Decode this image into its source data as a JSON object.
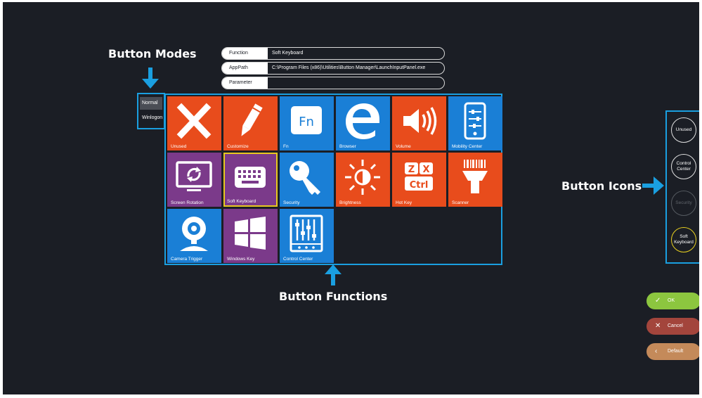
{
  "callouts": {
    "button_modes": "Button Modes",
    "button_functions": "Button Functions",
    "button_icons": "Button Icons"
  },
  "fields": [
    {
      "label": "Function",
      "value": "Soft Keyboard"
    },
    {
      "label": "AppPath",
      "value": "C:\\Program Files (x86)\\Utilities\\Button Manager\\LaunchInputPanel.exe"
    },
    {
      "label": "Parameter",
      "value": ""
    }
  ],
  "modes": [
    {
      "label": "Normal",
      "selected": true
    },
    {
      "label": "Winlogon",
      "selected": false
    }
  ],
  "tiles": [
    {
      "label": "Unused",
      "color": "#e84c1c",
      "icon": "close-x-icon"
    },
    {
      "label": "Customize",
      "color": "#e84c1c",
      "icon": "pencil-icon"
    },
    {
      "label": "Fn",
      "color": "#1a7fd6",
      "icon": "fn-key-icon"
    },
    {
      "label": "Browser",
      "color": "#1a7fd6",
      "icon": "edge-browser-icon"
    },
    {
      "label": "Volume",
      "color": "#e84c1c",
      "icon": "speaker-icon"
    },
    {
      "label": "Mobility Center",
      "color": "#1a7fd6",
      "icon": "mobility-sliders-icon"
    },
    {
      "label": "Screen Rotation",
      "color": "#7b3a8a",
      "icon": "screen-rotation-icon"
    },
    {
      "label": "Soft Keyboard",
      "color": "#7b3a8a",
      "icon": "keyboard-icon",
      "highlighted": true
    },
    {
      "label": "Security",
      "color": "#1a7fd6",
      "icon": "key-icon"
    },
    {
      "label": "Brightness",
      "color": "#e84c1c",
      "icon": "brightness-sun-icon"
    },
    {
      "label": "Hot Key",
      "color": "#e84c1c",
      "icon": "hot-key-icon"
    },
    {
      "label": "Scanner",
      "color": "#e84c1c",
      "icon": "barcode-scanner-icon"
    },
    {
      "label": "Camera Trigger",
      "color": "#1a7fd6",
      "icon": "webcam-icon"
    },
    {
      "label": "Windows Key",
      "color": "#7b3a8a",
      "icon": "windows-logo-icon"
    },
    {
      "label": "Control Center",
      "color": "#1a7fd6",
      "icon": "control-center-icon"
    }
  ],
  "hotkey_text": {
    "a": "Z",
    "b": "X",
    "c": "Ctrl"
  },
  "fn_text": "Fn",
  "button_icons": [
    {
      "label": "Unused",
      "state": "normal"
    },
    {
      "label": "Control Center",
      "state": "normal"
    },
    {
      "label": "Security",
      "state": "disabled"
    },
    {
      "label": "Soft Keyboard",
      "state": "selected"
    }
  ],
  "actions": [
    {
      "label": "OK",
      "icon": "check-icon",
      "color": "#8cc63f"
    },
    {
      "label": "Cancel",
      "icon": "close-icon",
      "color": "#a3453c"
    },
    {
      "label": "Default",
      "icon": "back-arrow-icon",
      "color": "#c48a5a"
    }
  ]
}
